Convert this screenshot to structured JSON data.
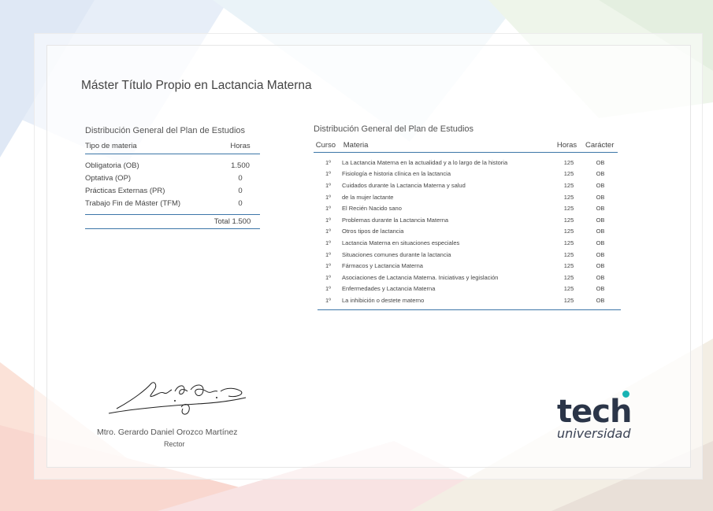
{
  "document": {
    "title": "Máster Título Propio en Lactancia Materna"
  },
  "summary_table": {
    "caption": "Distribución General del Plan de Estudios",
    "headers": [
      "Tipo de materia",
      "Horas"
    ],
    "rows": [
      {
        "tipo": "Obligatoria (OB)",
        "horas": "1.500"
      },
      {
        "tipo": "Optativa (OP)",
        "horas": "0"
      },
      {
        "tipo": "Prácticas Externas (PR)",
        "horas": "0"
      },
      {
        "tipo": "Trabajo Fin de Máster (TFM)",
        "horas": "0"
      }
    ],
    "total": "Total 1.500"
  },
  "detail_table": {
    "caption": "Distribución General del Plan de Estudios",
    "headers": [
      "Curso",
      "Materia",
      "Horas",
      "Carácter"
    ],
    "rows": [
      {
        "curso": "1º",
        "materia": "La Lactancia Materna en la actualidad y a lo largo de la historia",
        "horas": "125",
        "caracter": "OB"
      },
      {
        "curso": "1º",
        "materia": "Fisiología e historia clínica en la lactancia",
        "horas": "125",
        "caracter": "OB"
      },
      {
        "curso": "1º",
        "materia": "Cuidados durante la Lactancia Materna y salud",
        "horas": "125",
        "caracter": "OB"
      },
      {
        "curso": "1º",
        "materia": "de la mujer lactante",
        "horas": "125",
        "caracter": "OB"
      },
      {
        "curso": "1º",
        "materia": "El Recién Nacido sano",
        "horas": "125",
        "caracter": "OB"
      },
      {
        "curso": "1º",
        "materia": "Problemas durante la Lactancia Materna",
        "horas": "125",
        "caracter": "OB"
      },
      {
        "curso": "1º",
        "materia": "Otros tipos de lactancia",
        "horas": "125",
        "caracter": "OB"
      },
      {
        "curso": "1º",
        "materia": "Lactancia Materna en situaciones especiales",
        "horas": "125",
        "caracter": "OB"
      },
      {
        "curso": "1º",
        "materia": "Situaciones comunes durante la lactancia",
        "horas": "125",
        "caracter": "OB"
      },
      {
        "curso": "1º",
        "materia": "Fármacos y Lactancia Materna",
        "horas": "125",
        "caracter": "OB"
      },
      {
        "curso": "1º",
        "materia": "Asociaciones de Lactancia Materna. Iniciativas y legislación",
        "horas": "125",
        "caracter": "OB"
      },
      {
        "curso": "1º",
        "materia": "Enfermedades y Lactancia Materna",
        "horas": "125",
        "caracter": "OB"
      },
      {
        "curso": "1º",
        "materia": "La inhibición o destete materno",
        "horas": "125",
        "caracter": "OB"
      }
    ]
  },
  "signatory": {
    "name": "Mtro. Gerardo Daniel Orozco Martínez",
    "role": "Rector"
  },
  "logo": {
    "word": "tech",
    "sub": "universidad",
    "accent_color": "#17b3b3"
  },
  "colors": {
    "rule": "#3c76a8",
    "logo_dark": "#2b3548"
  }
}
